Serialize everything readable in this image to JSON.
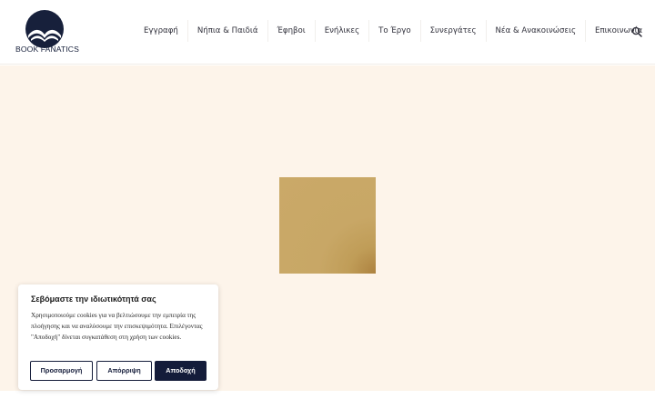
{
  "brand": {
    "name": "BOOK FANATICS",
    "logo_icon": "open-book-circle-icon",
    "color": "#17203b"
  },
  "nav": {
    "items": [
      {
        "label": "Εγγραφή"
      },
      {
        "label": "Νήπια & Παιδιά"
      },
      {
        "label": "Έφηβοι"
      },
      {
        "label": "Ενήλικες"
      },
      {
        "label": "Το Έργο"
      },
      {
        "label": "Συνεργάτες"
      },
      {
        "label": "Νέα & Ανακοινώσεις"
      },
      {
        "label": "Επικοινωνία"
      }
    ],
    "search_icon": "search-icon"
  },
  "hero": {
    "background": "#fdf4ea",
    "tile_color": "#c8a766"
  },
  "cookie_banner": {
    "title": "Σεβόμαστε την ιδιωτικότητά σας",
    "text": "Χρησιμοποιούμε cookies για να βελτιώσουμε την εμπειρία της πλοήγησης και να αναλύσουμε την επισκεψιμότητα. Επιλέγοντας \"Αποδοχή\" δίνεται συγκατάθεση στη χρήση των cookies.",
    "buttons": {
      "customize": "Προσαρμογή",
      "reject": "Απόρριψη",
      "accept": "Αποδοχή"
    },
    "accent_color": "#141c3a"
  }
}
